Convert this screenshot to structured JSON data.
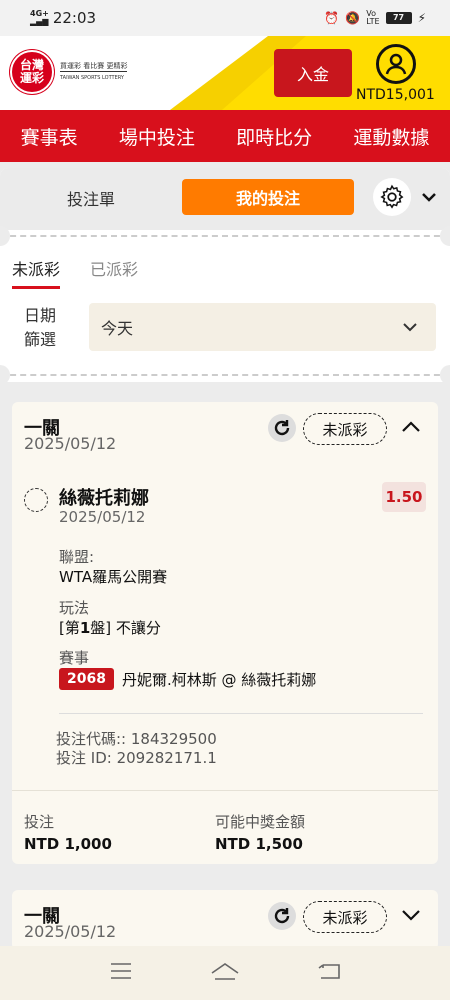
{
  "status_bar": {
    "network": "4G+",
    "time": "22:03",
    "battery": "77"
  },
  "header": {
    "logo_line1": "台灣",
    "logo_line2": "運彩",
    "logo_tagline": "買運彩 看比賽 更精彩",
    "logo_en": "TAIWAN SPORTS LOTTERY",
    "deposit_label": "入金",
    "balance": "NTD15,001"
  },
  "nav": {
    "items": [
      "賽事表",
      "場中投注",
      "即時比分",
      "運動數據"
    ]
  },
  "panel": {
    "tab_slip": "投注單",
    "tab_mine": "我的投注",
    "subtab_unsettled": "未派彩",
    "subtab_settled": "已派彩",
    "date_label_1": "日期",
    "date_label_2": "篩選",
    "date_value": "今天"
  },
  "bets": [
    {
      "title": "一關",
      "date": "2025/05/12",
      "status": "未派彩",
      "selection_name": "絲薇托莉娜",
      "selection_date": "2025/05/12",
      "odds": "1.50",
      "league_label": "聯盟:",
      "league_value": "WTA羅馬公開賽",
      "market_label": "玩法",
      "market_prefix": "[第",
      "market_num": "1",
      "market_suffix": "盤] 不讓分",
      "event_label": "賽事",
      "event_code": "2068",
      "event_name": "丹妮爾.柯林斯 @ 絲薇托莉娜",
      "bet_code": "投注代碼:: 184329500",
      "bet_id": "投注 ID: 209282171.1",
      "stake_label": "投注",
      "stake_value": "NTD 1,000",
      "payout_label": "可能中獎金額",
      "payout_value": "NTD 1,500"
    },
    {
      "title": "一關",
      "date": "2025/05/12",
      "status": "未派彩"
    }
  ],
  "icons": {
    "user": "user-icon",
    "gear": "gear-icon",
    "refresh": "refresh-icon",
    "chevron_down": "chevron-down-icon",
    "chevron_up": "chevron-up-icon",
    "menu": "menu-icon",
    "home": "home-icon",
    "back": "back-icon"
  },
  "colors": {
    "brand_red": "#d8101c",
    "accent_orange": "#ff7b00",
    "header_yellow": "#ffdd00"
  }
}
